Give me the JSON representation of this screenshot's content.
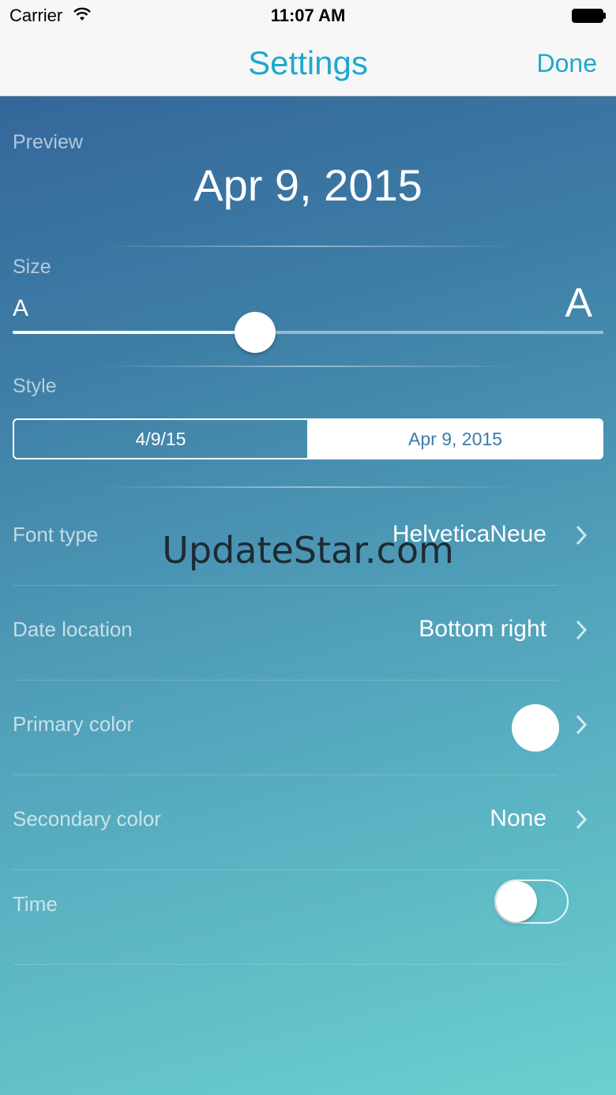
{
  "status_bar": {
    "carrier": "Carrier",
    "time": "11:07 AM"
  },
  "nav": {
    "title": "Settings",
    "done_label": "Done"
  },
  "preview": {
    "label": "Preview",
    "date": "Apr 9, 2015"
  },
  "size": {
    "label": "Size",
    "small_glyph": "A",
    "large_glyph": "A",
    "slider_fraction": 0.41
  },
  "style": {
    "label": "Style",
    "options": [
      "4/9/15",
      "Apr 9, 2015"
    ],
    "selected": "Apr 9, 2015"
  },
  "rows": {
    "font_type": {
      "label": "Font type",
      "value": "HelveticaNeue"
    },
    "date_location": {
      "label": "Date location",
      "value": "Bottom right"
    },
    "primary_color": {
      "label": "Primary color",
      "swatch": "#ffffff"
    },
    "secondary_color": {
      "label": "Secondary color",
      "value": "None"
    },
    "time": {
      "label": "Time",
      "enabled": false
    }
  },
  "watermark": "UpdateStar.com"
}
